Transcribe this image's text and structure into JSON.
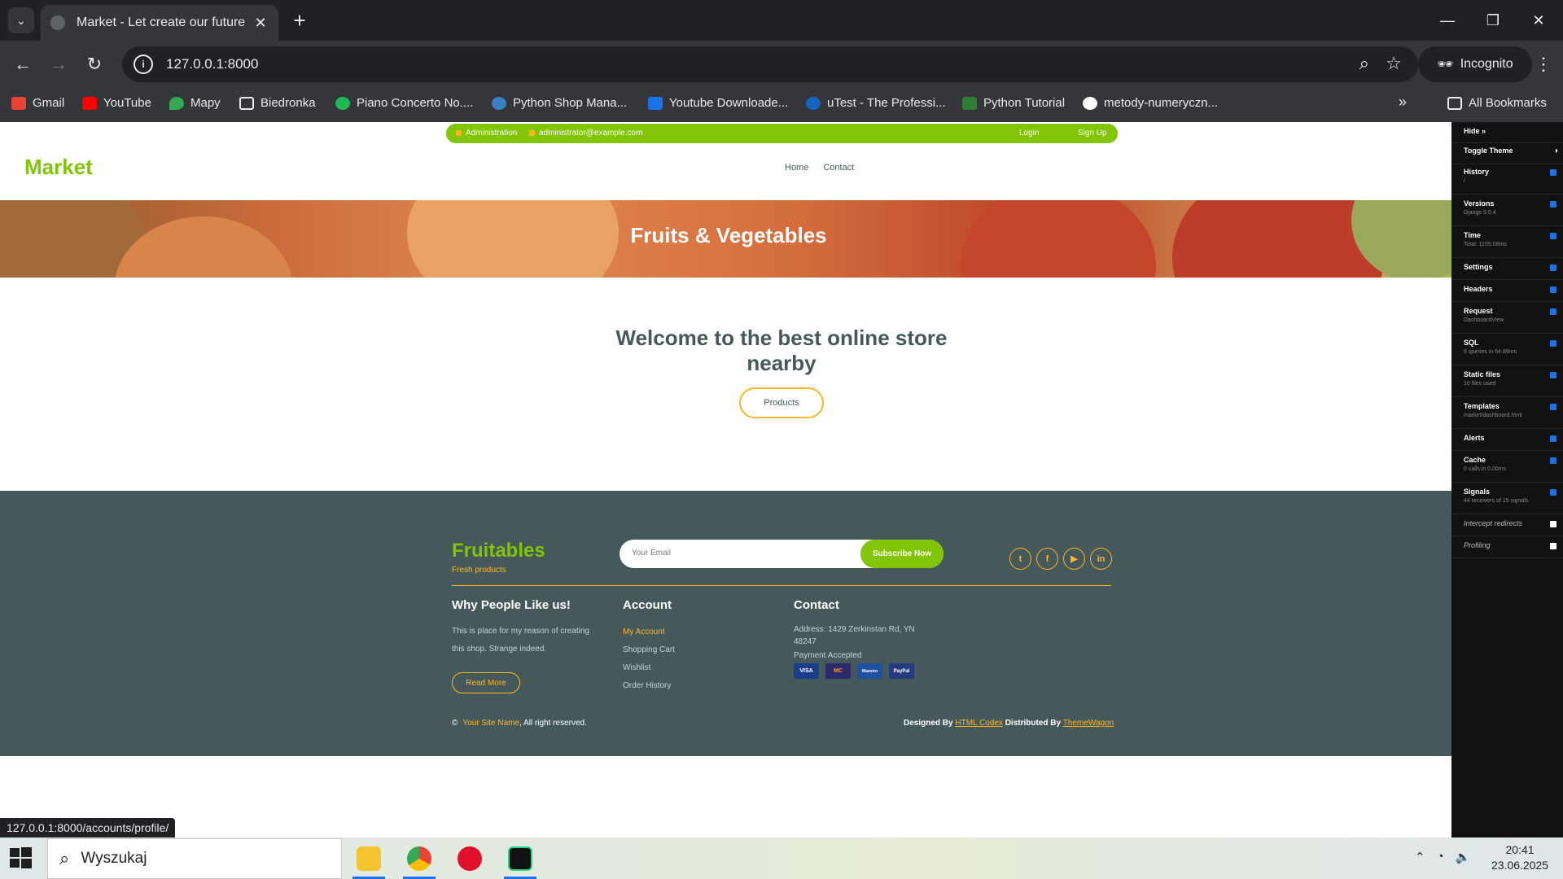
{
  "browser": {
    "tab_title": "Market - Let create our future",
    "url": "127.0.0.1:8000",
    "incognito_label": "Incognito",
    "bookmarks": [
      {
        "label": "Gmail",
        "color": "#ea4335"
      },
      {
        "label": "YouTube",
        "color": "#ff0000"
      },
      {
        "label": "Mapy",
        "color": "#34a853"
      },
      {
        "label": "Biedronka",
        "color": "folder"
      },
      {
        "label": "Piano Concerto No....",
        "color": "#1db954"
      },
      {
        "label": "Python Shop Mana...",
        "color": "#3b82c4"
      },
      {
        "label": "Youtube Downloade...",
        "color": "#1a73e8"
      },
      {
        "label": "uTest - The Professi...",
        "color": "#1565c0"
      },
      {
        "label": "Python Tutorial",
        "color": "#2e7d32"
      },
      {
        "label": "metody-numeryczn...",
        "color": "#ffffff"
      }
    ],
    "all_bookmarks_label": "All Bookmarks",
    "status_url": "127.0.0.1:8000/accounts/profile/"
  },
  "site": {
    "topbar": {
      "phone_label": "Administration",
      "email": "administrator@example.com",
      "login": "Login",
      "signup": "Sign Up"
    },
    "brand": "Market",
    "nav": [
      "Home",
      "Contact"
    ],
    "hero_title": "Fruits & Vegetables",
    "welcome": "Welcome to the best online store nearby",
    "products_button": "Products"
  },
  "footer": {
    "brand": "Fruitables",
    "tagline": "Fresh products",
    "email_placeholder": "Your Email",
    "subscribe_label": "Subscribe Now",
    "social_icons": [
      "twitter-icon",
      "facebook-icon",
      "youtube-icon",
      "linkedin-icon"
    ],
    "why_title": "Why People Like us!",
    "why_text": "This is place for my reason of creating this shop. Strange indeed.",
    "read_more": "Read More",
    "account_title": "Account",
    "account_links": [
      "My Account",
      "Shopping Cart",
      "Wishlist",
      "Order History"
    ],
    "contact_title": "Contact",
    "address": "Address: 1429 Zerkinstan Rd, YN 48247",
    "payment_label": "Payment Accepted",
    "cards": [
      "VISA",
      "MC",
      "Maestro",
      "PayPal"
    ],
    "copyright_site": "Your Site Name",
    "copyright_rest": ", All right reserved.",
    "designed_by": "Designed By",
    "designer": "HTML Codex",
    "distributed_by": "Distributed By",
    "distributor": "ThemeWagon",
    "accent": "#81c408",
    "secondary": "#ffb524",
    "footer_bg": "#45595b"
  },
  "djdt": {
    "hide_label": "Hide »",
    "toggle_theme": "Toggle Theme",
    "panels": [
      {
        "label": "History",
        "sub": "/",
        "checked": true
      },
      {
        "label": "Versions",
        "sub": "Django 5.0.4",
        "checked": true
      },
      {
        "label": "Time",
        "sub": "Total: 1155.08ms",
        "checked": true
      },
      {
        "label": "Settings",
        "sub": "",
        "checked": true
      },
      {
        "label": "Headers",
        "sub": "",
        "checked": true
      },
      {
        "label": "Request",
        "sub": "DashboardView",
        "checked": true
      },
      {
        "label": "SQL",
        "sub": "6 queries in 64.89ms",
        "checked": true
      },
      {
        "label": "Static files",
        "sub": "10 files used",
        "checked": true
      },
      {
        "label": "Templates",
        "sub": "market/dashboard.html",
        "checked": true
      },
      {
        "label": "Alerts",
        "sub": "",
        "checked": true
      },
      {
        "label": "Cache",
        "sub": "0 calls in 0.00ms",
        "checked": true
      },
      {
        "label": "Signals",
        "sub": "44 receivers of 15 signals",
        "checked": true
      },
      {
        "label": "Intercept redirects",
        "sub": "",
        "checked": false
      },
      {
        "label": "Profiling",
        "sub": "",
        "checked": false
      }
    ]
  },
  "taskbar": {
    "search_placeholder": "Wyszukaj",
    "time": "20:41",
    "date": "23.06.2025"
  }
}
